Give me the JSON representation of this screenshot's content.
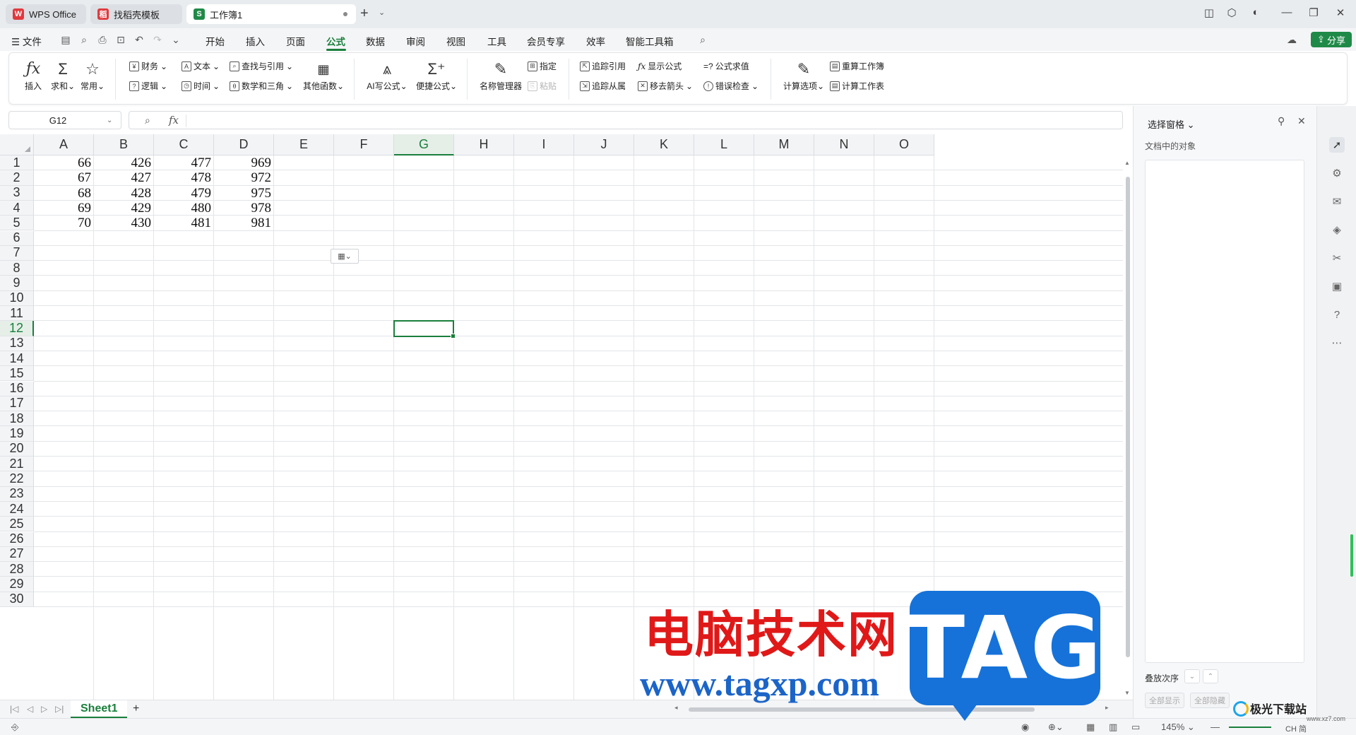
{
  "titlebar": {
    "tabs": [
      {
        "label": "WPS Office",
        "logo": "W",
        "logo_color": "#e0393e"
      },
      {
        "label": "找稻壳模板",
        "logo": "稻",
        "logo_color": "#e0393e"
      },
      {
        "label": "工作簿1",
        "logo": "S",
        "logo_color": "#1f8a48"
      }
    ]
  },
  "menubar": {
    "file_label": "文件",
    "tabs": [
      "开始",
      "插入",
      "页面",
      "公式",
      "数据",
      "审阅",
      "视图",
      "工具",
      "会员专享",
      "效率",
      "智能工具箱"
    ],
    "active_tab": "公式",
    "share_label": "分享"
  },
  "ribbon": {
    "insert": "插入",
    "sum": "求和",
    "common": "常用",
    "finance": "财务",
    "text": "文本",
    "lookup": "查找与引用",
    "logic": "逻辑",
    "time": "时间",
    "math": "数学和三角",
    "other": "其他函数",
    "ai_formula": "AI写公式",
    "quick_formula": "便捷公式",
    "name_manager": "名称管理器",
    "specify": "指定",
    "paste": "粘贴",
    "trace_precedents": "追踪引用",
    "trace_dependents": "追踪从属",
    "show_formulas": "显示公式",
    "remove_arrows": "移去箭头",
    "evaluate": "公式求值",
    "error_check": "错误检查",
    "calc_options": "计算选项",
    "recalc_book": "重算工作簿",
    "calc_sheet": "计算工作表"
  },
  "formula_bar": {
    "name_box": "G12",
    "fx": "fx",
    "content": ""
  },
  "grid": {
    "columns": [
      "A",
      "B",
      "C",
      "D",
      "E",
      "F",
      "G",
      "H",
      "I",
      "J",
      "K",
      "L",
      "M",
      "N",
      "O"
    ],
    "rows": [
      "1",
      "2",
      "3",
      "4",
      "5",
      "6",
      "7",
      "8",
      "9",
      "10",
      "11",
      "12",
      "13",
      "14",
      "15",
      "16",
      "17",
      "18",
      "19",
      "20",
      "21",
      "22",
      "23",
      "24",
      "25",
      "26",
      "27",
      "28",
      "29",
      "30"
    ],
    "selected_col": "G",
    "selected_row": "12",
    "data": [
      [
        "66",
        "426",
        "477",
        "969"
      ],
      [
        "67",
        "427",
        "478",
        "972"
      ],
      [
        "68",
        "428",
        "479",
        "975"
      ],
      [
        "69",
        "429",
        "480",
        "978"
      ],
      [
        "70",
        "430",
        "481",
        "981"
      ]
    ]
  },
  "sheets": {
    "tabs": [
      "Sheet1"
    ],
    "add": "+"
  },
  "selection_pane": {
    "title": "选择窗格",
    "subtitle": "文档中的对象",
    "order_label": "叠放次序",
    "show_all": "全部显示",
    "hide_all": "全部隐藏"
  },
  "statusbar": {
    "zoom": "145%",
    "ime": "CH 简"
  },
  "watermark": {
    "cn_text": "电脑技术网",
    "url": "www.tagxp.com",
    "tag": "TAG",
    "site": "极光下载站",
    "site_url": "www.xz7.com"
  }
}
